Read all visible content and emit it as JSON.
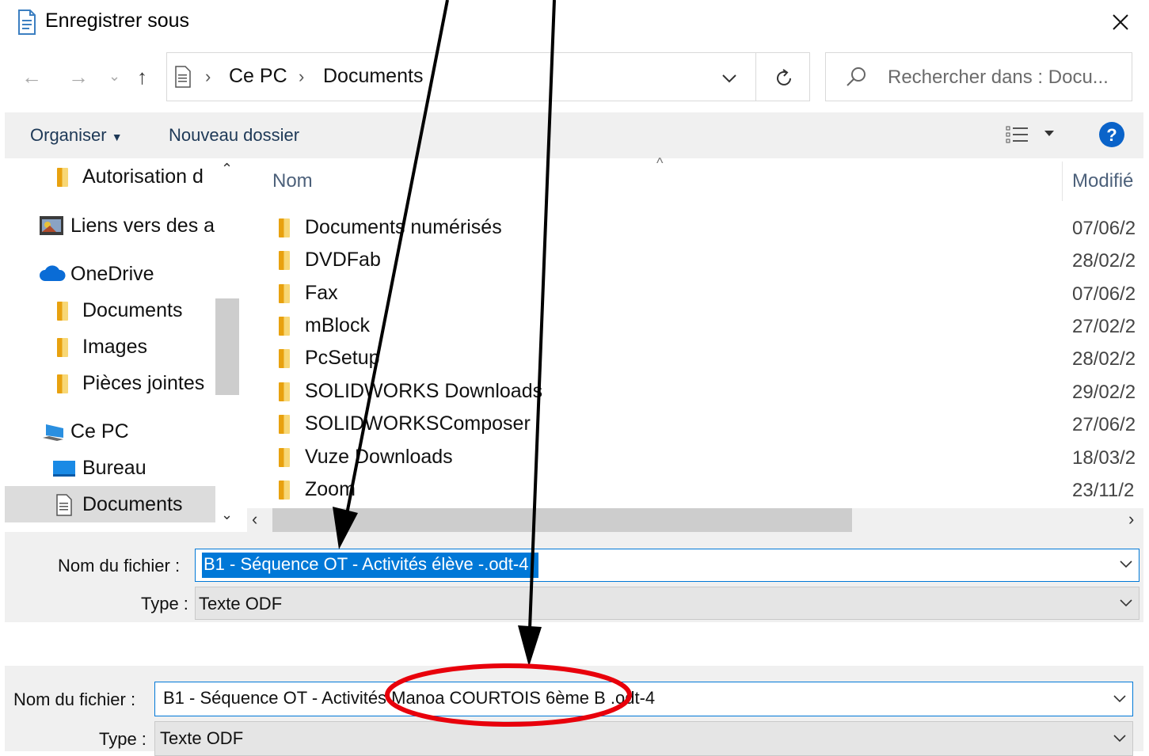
{
  "window": {
    "title": "Enregistrer sous"
  },
  "address_bar": {
    "crumbs": [
      "Ce PC",
      "Documents"
    ],
    "search_placeholder": "Rechercher dans : Docu..."
  },
  "toolbar": {
    "organize_label": "Organiser",
    "new_folder_label": "Nouveau dossier"
  },
  "navigation": {
    "items": [
      {
        "label": "Autorisation d",
        "icon": "folder-icon"
      },
      {
        "label": "Liens vers des a",
        "icon": "links-icon"
      },
      {
        "label": "OneDrive",
        "icon": "cloud-icon"
      },
      {
        "label": "Documents",
        "icon": "folder-icon"
      },
      {
        "label": "Images",
        "icon": "folder-icon"
      },
      {
        "label": "Pièces jointes",
        "icon": "folder-icon"
      },
      {
        "label": "Ce PC",
        "icon": "computer-icon"
      },
      {
        "label": "Bureau",
        "icon": "desktop-icon"
      },
      {
        "label": "Documents",
        "icon": "document-icon"
      }
    ]
  },
  "file_list": {
    "columns": {
      "name": "Nom",
      "modified": "Modifié"
    },
    "rows": [
      {
        "name": "Documents numérisés",
        "modified": "07/06/2"
      },
      {
        "name": "DVDFab",
        "modified": "28/02/2"
      },
      {
        "name": "Fax",
        "modified": "07/06/2"
      },
      {
        "name": "mBlock",
        "modified": "27/02/2"
      },
      {
        "name": "PcSetup",
        "modified": "28/02/2"
      },
      {
        "name": "SOLIDWORKS Downloads",
        "modified": "29/02/2"
      },
      {
        "name": "SOLIDWORKSComposer",
        "modified": "27/06/2"
      },
      {
        "name": "Vuze Downloads",
        "modified": "18/03/2"
      },
      {
        "name": "Zoom",
        "modified": "23/11/2"
      }
    ]
  },
  "save_panel_before": {
    "filename_label": "Nom du fichier :",
    "filename_value": "B1 - Séquence OT - Activités élève -.odt-4",
    "type_label": "Type :",
    "type_value": "Texte ODF"
  },
  "save_panel_after": {
    "filename_label": "Nom du fichier :",
    "filename_value": "B1 - Séquence OT - Activités Manoa COURTOIS 6ème B .odt-4",
    "type_label": "Type :",
    "type_value": "Texte ODF"
  },
  "colors": {
    "accent": "#0078d7",
    "annotation_arrow": "#000000",
    "annotation_circle": "#e8000b"
  }
}
